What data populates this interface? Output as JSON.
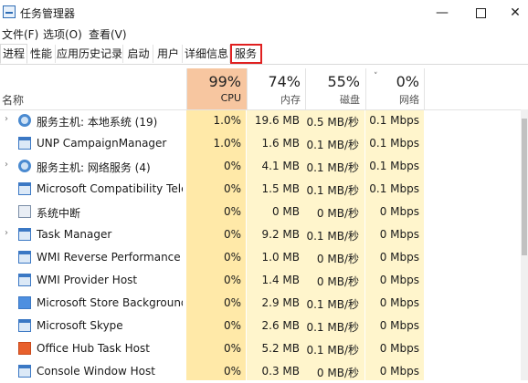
{
  "window": {
    "title": "任务管理器"
  },
  "menu": [
    "文件(F)",
    "选项(O)",
    "查看(V)"
  ],
  "tabs": [
    "进程",
    "性能",
    "应用历史记录",
    "启动",
    "用户",
    "详细信息",
    "服务"
  ],
  "active_tab": "进程",
  "highlighted_tab": "服务",
  "header": {
    "name_label": "名称",
    "cpu": {
      "pct": "99%",
      "label": "CPU"
    },
    "memory": {
      "pct": "74%",
      "label": "内存"
    },
    "disk": {
      "pct": "55%",
      "label": "磁盘"
    },
    "network": {
      "pct": "0%",
      "label": "网络"
    }
  },
  "colors": {
    "cpu_header": "#f7c6a0",
    "cpu_col": "#ffe9a8",
    "col_bg": "#fff5cc",
    "tab_highlight": "#e02020"
  },
  "rows": [
    {
      "expand": true,
      "icon": "gear-icon",
      "name": "服务主机: 本地系统 (19)",
      "cpu": "1.0%",
      "mem": "19.6 MB",
      "disk": "0.5 MB/秒",
      "net": "0.1 Mbps"
    },
    {
      "expand": false,
      "icon": "window-icon",
      "name": "UNP CampaignManager",
      "cpu": "1.0%",
      "mem": "1.6 MB",
      "disk": "0.1 MB/秒",
      "net": "0.1 Mbps"
    },
    {
      "expand": true,
      "icon": "gear-icon",
      "name": "服务主机: 网络服务 (4)",
      "cpu": "0%",
      "mem": "4.1 MB",
      "disk": "0.1 MB/秒",
      "net": "0.1 Mbps"
    },
    {
      "expand": false,
      "icon": "window-icon",
      "name": "Microsoft Compatibility Tele...",
      "cpu": "0%",
      "mem": "1.5 MB",
      "disk": "0.1 MB/秒",
      "net": "0.1 Mbps"
    },
    {
      "expand": false,
      "icon": "system-icon",
      "name": "系统中断",
      "cpu": "0%",
      "mem": "0 MB",
      "disk": "0 MB/秒",
      "net": "0 Mbps"
    },
    {
      "expand": true,
      "icon": "window-icon",
      "name": "Task Manager",
      "cpu": "0%",
      "mem": "9.2 MB",
      "disk": "0.1 MB/秒",
      "net": "0 Mbps"
    },
    {
      "expand": false,
      "icon": "window-icon",
      "name": "WMI Reverse Performance A...",
      "cpu": "0%",
      "mem": "1.0 MB",
      "disk": "0 MB/秒",
      "net": "0 Mbps"
    },
    {
      "expand": false,
      "icon": "window-icon",
      "name": "WMI Provider Host",
      "cpu": "0%",
      "mem": "1.4 MB",
      "disk": "0 MB/秒",
      "net": "0 Mbps"
    },
    {
      "expand": false,
      "icon": "store-icon",
      "name": "Microsoft Store Background...",
      "cpu": "0%",
      "mem": "2.9 MB",
      "disk": "0.1 MB/秒",
      "net": "0 Mbps"
    },
    {
      "expand": false,
      "icon": "window-icon",
      "name": "Microsoft Skype",
      "cpu": "0%",
      "mem": "2.6 MB",
      "disk": "0.1 MB/秒",
      "net": "0 Mbps"
    },
    {
      "expand": false,
      "icon": "office-icon",
      "name": "Office Hub Task Host",
      "cpu": "0%",
      "mem": "5.2 MB",
      "disk": "0.1 MB/秒",
      "net": "0 Mbps"
    },
    {
      "expand": false,
      "icon": "window-icon",
      "name": "Console Window Host",
      "cpu": "0%",
      "mem": "0.3 MB",
      "disk": "0 MB/秒",
      "net": "0 Mbps"
    }
  ]
}
